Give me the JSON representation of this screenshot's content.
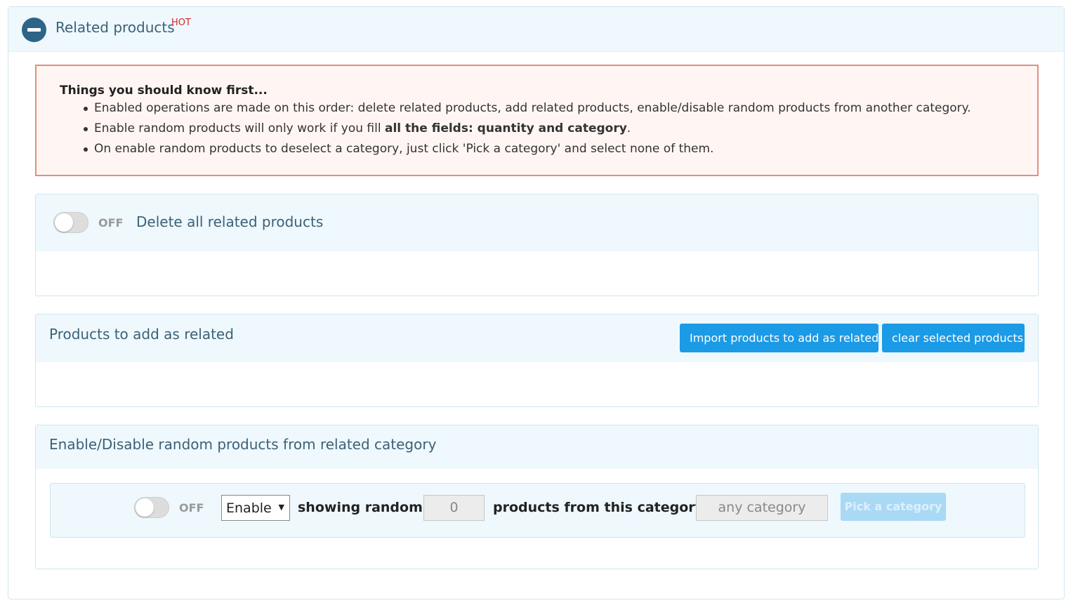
{
  "header": {
    "title": "Related products",
    "badge": "HOT"
  },
  "notice": {
    "title": "Things you should know first...",
    "items": [
      {
        "text": "Enabled operations are made on this order: delete related products, add related products, enable/disable random products from another category."
      },
      {
        "pre": "Enable random products will only work if you fill ",
        "bold": "all the fields: quantity and category",
        "post": "."
      },
      {
        "text": "On enable random products to deselect a category, just click 'Pick a category' and select none of them."
      }
    ]
  },
  "delete_panel": {
    "toggle_state": "OFF",
    "label": "Delete all related products"
  },
  "add_panel": {
    "title": "Products to add as related",
    "import_button": "Import products to add as related",
    "clear_button": "clear selected products"
  },
  "random_panel": {
    "title": "Enable/Disable random products from related category",
    "toggle_state": "OFF",
    "mode_select": {
      "selected": "Enable"
    },
    "showing_label": "showing random",
    "quantity_value": "0",
    "category_label": "products from this category",
    "category_value": "any category",
    "pick_button": "Pick a category"
  },
  "colors": {
    "primary_button": "#1b9ae6",
    "panel_header_bg": "#eef8fd",
    "notice_border": "#e18f7e",
    "hot_badge": "#d42a2a"
  }
}
